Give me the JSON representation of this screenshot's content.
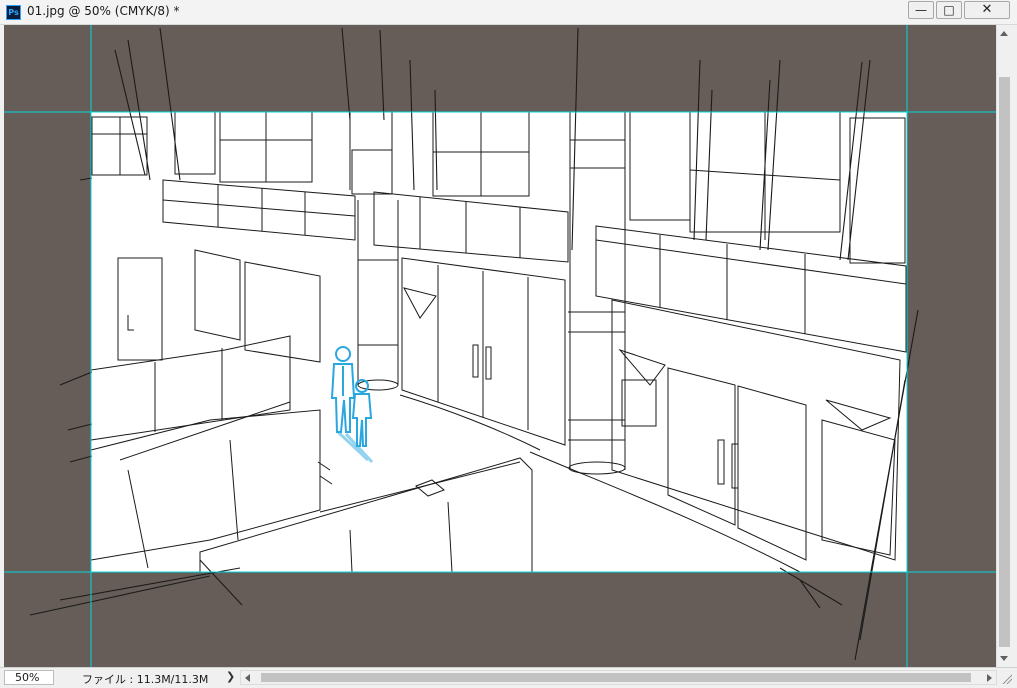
{
  "window": {
    "app_icon_label": "Ps",
    "title": "01.jpg @ 50% (CMYK/8) *",
    "minimize_glyph": "—",
    "maximize_glyph": "□",
    "close_glyph": "✕"
  },
  "status": {
    "zoom": "50%",
    "file_info": "ファイル : 11.3M/11.3M",
    "menu_arrow": "❯"
  },
  "colors": {
    "pasteboard": "#675d58",
    "guide": "#00d8e0",
    "figure": "#2aa7df",
    "ink": "#1b1b1b"
  },
  "icons": {
    "app": "photoshop-icon",
    "minimize": "minimize-icon",
    "maximize": "maximize-icon",
    "close": "close-icon"
  }
}
